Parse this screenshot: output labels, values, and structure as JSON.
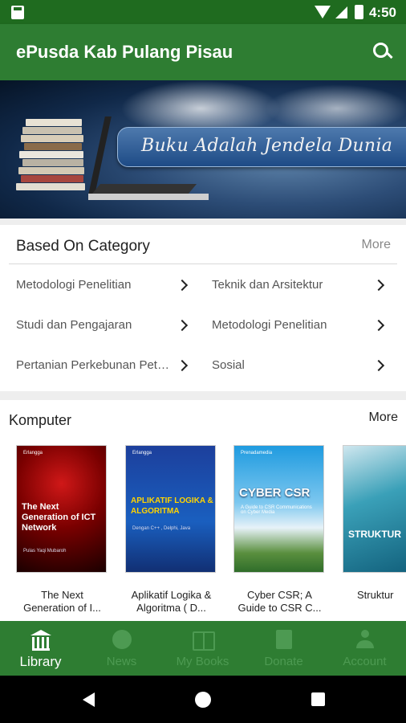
{
  "status_bar": {
    "time": "4:50"
  },
  "app_bar": {
    "title": "ePusda Kab Pulang Pisau",
    "search_icon": "search-icon"
  },
  "banner": {
    "caption": "Buku Adalah Jendela Dunia"
  },
  "category_section": {
    "heading": "Based On Category",
    "more_label": "More",
    "items": [
      {
        "label": "Metodologi Penelitian"
      },
      {
        "label": "Teknik dan Arsitektur"
      },
      {
        "label": "Studi dan Pengajaran"
      },
      {
        "label": "Metodologi Penelitian"
      },
      {
        "label": "Pertanian Perkebunan Peternakan"
      },
      {
        "label": "Sosial"
      }
    ]
  },
  "komputer_section": {
    "heading": "Komputer",
    "more_label": "More",
    "books": [
      {
        "caption": "The Next Generation of I...",
        "cover_title": "The Next Generation of ICT Network",
        "cover_subtitle": "Pulas Yaqi Mubaroh"
      },
      {
        "caption": "Aplikatif Logika & Algoritma ( D...",
        "cover_title": "APLIKATIF LOGIKA & ALGORITMA",
        "cover_subtitle": "Dengan C++ , Delphi, Java"
      },
      {
        "caption": "Cyber CSR; A Guide to CSR C...",
        "cover_title": "CYBER CSR",
        "cover_subtitle": "A Guide to CSR Communications on Cyber Media"
      },
      {
        "caption": "Struktur",
        "cover_title": "STRUKTUR",
        "cover_subtitle": ""
      }
    ]
  },
  "bottom_nav": {
    "items": [
      {
        "label": "Library",
        "icon": "library-icon",
        "active": true
      },
      {
        "label": "News",
        "icon": "globe-icon",
        "active": false
      },
      {
        "label": "My Books",
        "icon": "book-open-icon",
        "active": false
      },
      {
        "label": "Donate",
        "icon": "donate-book-icon",
        "active": false
      },
      {
        "label": "Account",
        "icon": "account-icon",
        "active": false
      }
    ]
  },
  "colors": {
    "primary": "#2e7d32",
    "status_bar": "#1f6b1f",
    "inactive_nav": "#4d9a52"
  }
}
